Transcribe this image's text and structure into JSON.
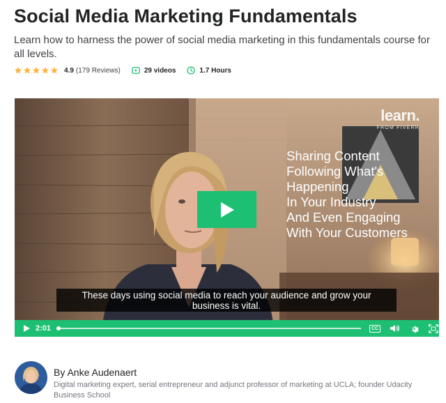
{
  "course": {
    "title": "Social Media Marketing Fundamentals",
    "subtitle": "Learn how to harness the power of social media marketing in this fundamentals course for all levels.",
    "rating": "4.9",
    "star_count": 5,
    "reviews": "(179 Reviews)",
    "videos": "29 videos",
    "duration": "1.7 Hours"
  },
  "video": {
    "logo_main": "learn.",
    "logo_sub": "FROM FIVERR",
    "overlay_lines": [
      "Sharing Content",
      "Following What's",
      "Happening",
      "In Your Industry",
      "And Even Engaging",
      "With Your Customers"
    ],
    "caption_line1": "These days using social media to reach your audience and grow your",
    "caption_line2": "business is vital.",
    "time": "2:01",
    "cc_label": "CC",
    "progress": 0.0
  },
  "author": {
    "name": "By Anke Audenaert",
    "bio": "Digital marketing expert, serial entrepreneur and adjunct professor of marketing at UCLA; founder Udacity Business School"
  },
  "colors": {
    "accent": "#1dbf73",
    "star": "#ffb33e",
    "text": "#222325",
    "muted": "#74767e"
  }
}
